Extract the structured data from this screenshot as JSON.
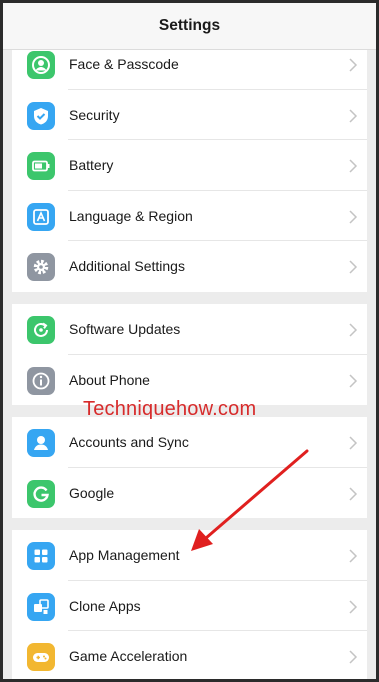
{
  "header": {
    "title": "Settings"
  },
  "groups": [
    {
      "items": [
        {
          "label": "Face & Passcode",
          "icon": "face-passcode-icon",
          "color": "#3cc66c"
        },
        {
          "label": "Security",
          "icon": "shield-icon",
          "color": "#36a6f2"
        },
        {
          "label": "Battery",
          "icon": "battery-icon",
          "color": "#3cc66c"
        },
        {
          "label": "Language & Region",
          "icon": "language-icon",
          "color": "#36a6f2"
        },
        {
          "label": "Additional Settings",
          "icon": "gear-icon",
          "color": "#8f96a1"
        }
      ]
    },
    {
      "items": [
        {
          "label": "Software Updates",
          "icon": "update-icon",
          "color": "#3cc66c"
        },
        {
          "label": "About Phone",
          "icon": "info-icon",
          "color": "#8f96a1"
        }
      ]
    },
    {
      "items": [
        {
          "label": "Accounts and Sync",
          "icon": "person-icon",
          "color": "#36a6f2"
        },
        {
          "label": "Google",
          "icon": "google-icon",
          "color": "#3cc66c"
        }
      ]
    },
    {
      "items": [
        {
          "label": "App Management",
          "icon": "apps-grid-icon",
          "color": "#36a6f2"
        },
        {
          "label": "Clone Apps",
          "icon": "clone-apps-icon",
          "color": "#36a6f2"
        },
        {
          "label": "Game Acceleration",
          "icon": "gamepad-icon",
          "color": "#f2b731"
        }
      ]
    }
  ],
  "watermark": "Techniquehow.com"
}
